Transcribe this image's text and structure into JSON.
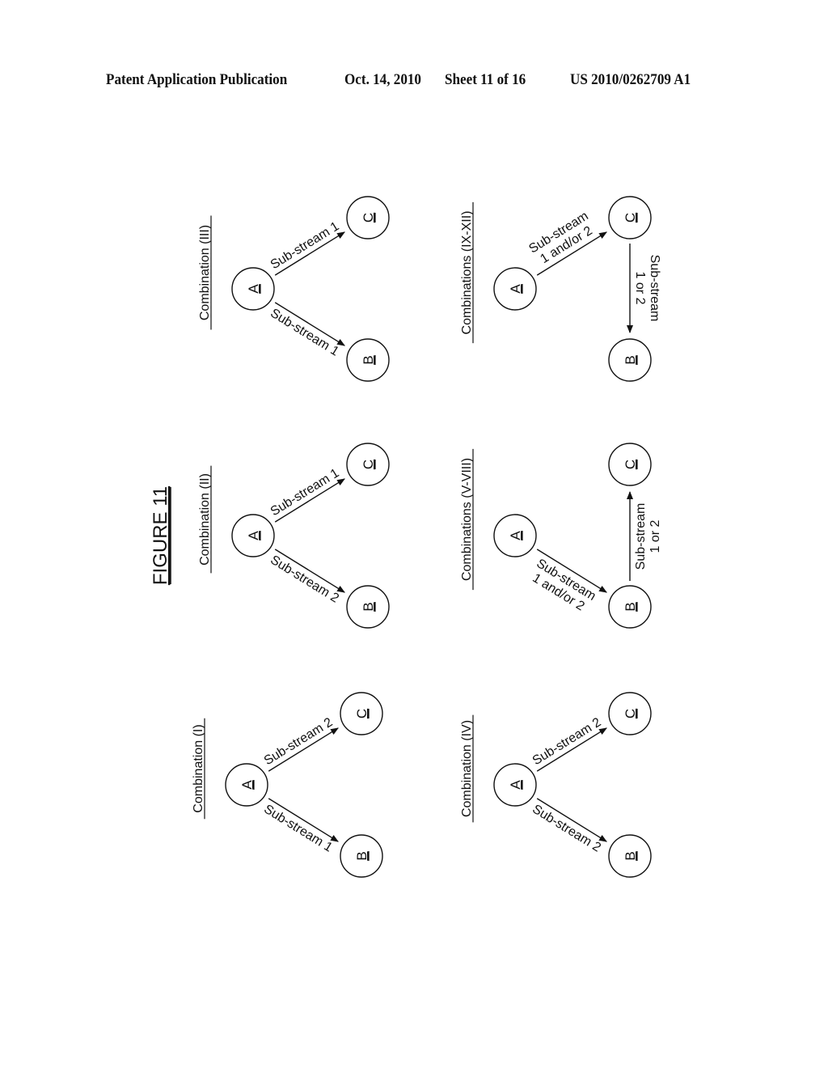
{
  "header": {
    "publication": "Patent Application Publication",
    "date": "Oct. 14, 2010",
    "sheet": "Sheet 11 of 16",
    "patent_number": "US 2010/0262709 A1"
  },
  "figure_title": "FIGURE 11",
  "diagrams": [
    {
      "id": "combination-iii",
      "title": "Combination (III)",
      "nodes": {
        "A": "A",
        "B": "B",
        "C": "C"
      },
      "edges": [
        {
          "from": "A",
          "to": "C",
          "label": [
            "Sub-stream 1"
          ]
        },
        {
          "from": "A",
          "to": "B",
          "label": [
            "Sub-stream 1"
          ]
        }
      ]
    },
    {
      "id": "combination-ii",
      "title": "Combination (II)",
      "nodes": {
        "A": "A",
        "B": "B",
        "C": "C"
      },
      "edges": [
        {
          "from": "A",
          "to": "C",
          "label": [
            "Sub-stream 1"
          ]
        },
        {
          "from": "A",
          "to": "B",
          "label": [
            "Sub-stream 2"
          ]
        }
      ]
    },
    {
      "id": "combination-i",
      "title": "Combination (I)",
      "nodes": {
        "A": "A",
        "B": "B",
        "C": "C"
      },
      "edges": [
        {
          "from": "A",
          "to": "C",
          "label": [
            "Sub-stream 2"
          ]
        },
        {
          "from": "A",
          "to": "B",
          "label": [
            "Sub-stream 1"
          ]
        }
      ]
    },
    {
      "id": "combinations-ix-xii",
      "title": "Combinations (IX-XII)",
      "nodes": {
        "A": "A",
        "B": "B",
        "C": "C"
      },
      "edges": [
        {
          "from": "A",
          "to": "C",
          "label": [
            "Sub-stream",
            "1 and/or 2"
          ]
        },
        {
          "from": "C",
          "to": "B",
          "label": [
            "Sub-stream",
            "1 or 2"
          ]
        }
      ]
    },
    {
      "id": "combinations-v-viii",
      "title": "Combinations (V-VIII)",
      "nodes": {
        "A": "A",
        "B": "B",
        "C": "C"
      },
      "edges": [
        {
          "from": "A",
          "to": "B",
          "label": [
            "Sub-stream",
            "1 and/or 2"
          ]
        },
        {
          "from": "B",
          "to": "C",
          "label": [
            "Sub-stream",
            "1 or 2"
          ]
        }
      ]
    },
    {
      "id": "combination-iv",
      "title": "Combination (IV)",
      "nodes": {
        "A": "A",
        "B": "B",
        "C": "C"
      },
      "edges": [
        {
          "from": "A",
          "to": "C",
          "label": [
            "Sub-stream 2"
          ]
        },
        {
          "from": "A",
          "to": "B",
          "label": [
            "Sub-stream 2"
          ]
        }
      ]
    }
  ]
}
